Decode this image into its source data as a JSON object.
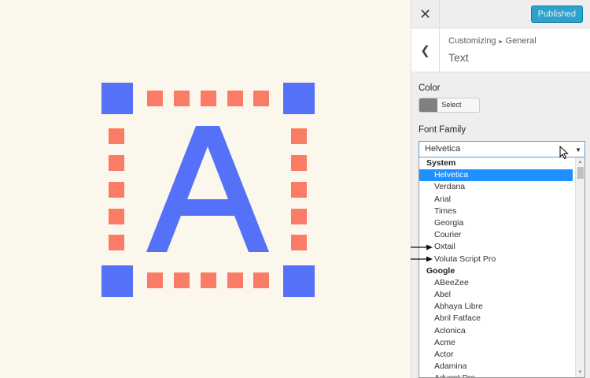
{
  "preview": {
    "letter": "A",
    "colors": {
      "corner": "#5471f7",
      "dot": "#fb7c66",
      "letter": "#5471f7",
      "background": "#fcf7ec"
    }
  },
  "topbar": {
    "close_icon": "close-icon",
    "publish_label": "Published",
    "accent": "#2ea2cc"
  },
  "header": {
    "back_icon": "chevron-left-icon",
    "breadcrumb": {
      "root": "Customizing",
      "section": "General"
    },
    "title": "Text"
  },
  "color_control": {
    "label": "Color",
    "button_label": "Select Color",
    "current_color": "#808080"
  },
  "font_control": {
    "label": "Font Family",
    "selected": "Helvetica",
    "groups": [
      {
        "name": "System",
        "options": [
          "Helvetica",
          "Verdana",
          "Arial",
          "Times",
          "Georgia",
          "Courier",
          "Oxtail",
          "Voluta Script Pro"
        ]
      },
      {
        "name": "Google",
        "options": [
          "ABeeZee",
          "Abel",
          "Abhaya Libre",
          "Abril Fatface",
          "Aclonica",
          "Acme",
          "Actor",
          "Adamina",
          "Advent Pro"
        ]
      }
    ],
    "annotated_options": [
      "Oxtail",
      "Voluta Script Pro"
    ],
    "highlight_color": "#1e90ff"
  }
}
